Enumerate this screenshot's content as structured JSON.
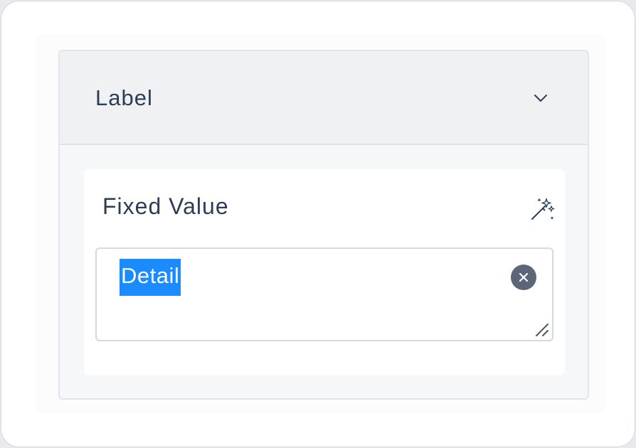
{
  "panel": {
    "title": "Label",
    "toggle_icon": "chevron-down-icon"
  },
  "field": {
    "label": "Fixed Value",
    "magic_icon": "magic-wand-icon",
    "value": "Detail",
    "value_selected": true,
    "clear_icon": "close-icon",
    "resize_icon": "resize-handle-icon"
  },
  "colors": {
    "text": "#2c3d55",
    "selection": "#1a8cff",
    "clear_button": "#5c6678"
  }
}
